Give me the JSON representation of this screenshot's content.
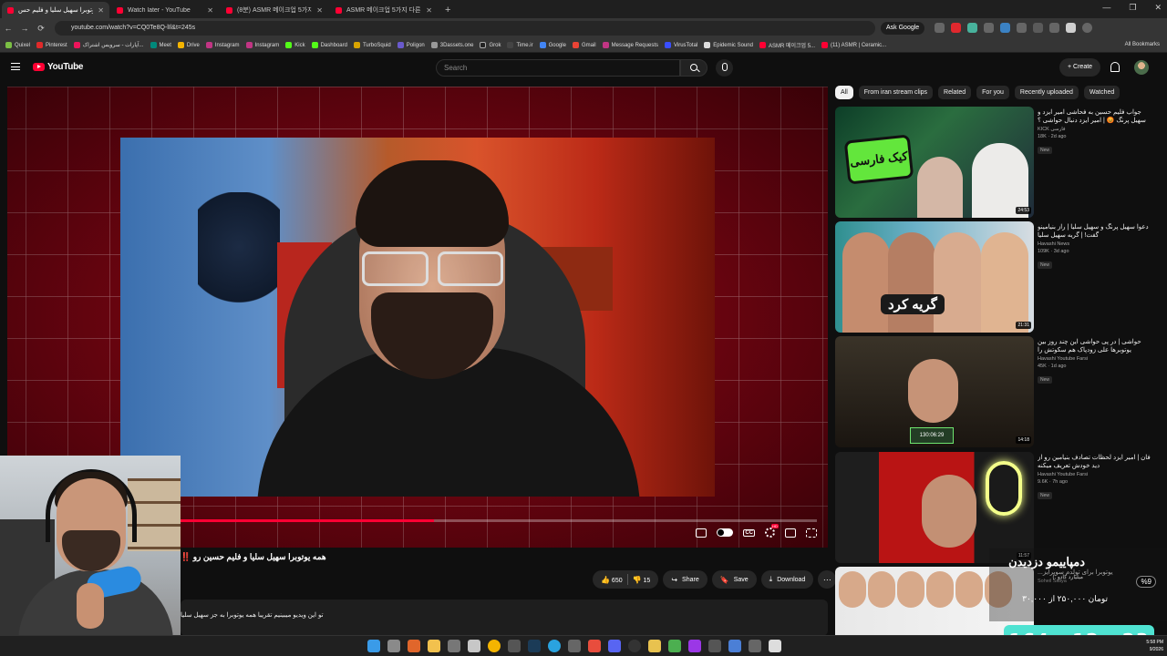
{
  "browser": {
    "tabs": [
      {
        "label": "همه یوتوبرا سهیل سلیا و فلیم حس...",
        "active": true
      },
      {
        "label": "Watch later - YouTube",
        "active": false
      },
      {
        "label": "(8분) ASMR 메이크업 5가지 ...",
        "active": false
      },
      {
        "label": "ASMR 메이크업 5가지 다른...",
        "active": false
      }
    ],
    "url": "youtube.com/watch?v=CQ0Te8Q-lIl&t=245s",
    "ask_google": "Ask Google",
    "bookmarks": [
      "Quixel",
      "Pinterest",
      "آپارات - سرویس اشتراک...",
      "Meet",
      "Drive",
      "Instagram",
      "Instagram",
      "Kick",
      "Dashboard",
      "TurboSquid",
      "Poligon",
      "3Dassets.one",
      "Grok",
      "Time.ir",
      "Google",
      "Gmail",
      "Message Requests",
      "VirusTotal",
      "Epidemic Sound",
      "ASMR 메이크업 5...",
      "(11) ASMR | Ceramic..."
    ],
    "all_bookmarks": "All Bookmarks"
  },
  "youtube": {
    "logo_text": "YouTube",
    "search_placeholder": "Search",
    "create_label": "Create"
  },
  "video": {
    "title": "همه یوتوبرا سهیل سلیا و فلیم حسین رو ‼️",
    "likes": "650",
    "dislikes": "15",
    "share_label": "Share",
    "save_label": "Save",
    "download_label": "Download",
    "description": "تو این ویدیو میبینیم تقریبا همه یوتوبرا به جز سهیل سلیا",
    "progress": 0.52
  },
  "chips": [
    "All",
    "From iran stream clips",
    "Related",
    "For you",
    "Recently uploaded",
    "Watched"
  ],
  "recommendations": [
    {
      "title": "جواب فلیم حسین به فحاشی امیر ایزد و سهیل پرنگ 😡 | امیر ایزد دنبال حواشی ؟",
      "channel": "KICK فارسی",
      "stats": "18K · 2d ago",
      "badge": "New",
      "duration": "24:53",
      "thumb_text": "کیک فارسی"
    },
    {
      "title": "دعوا سهیل پرنگ و سهیل سلیا | راز بنیامینو گفت! | گریه سهیل سلیا",
      "channel": "Havashi News",
      "stats": "109K · 3d ago",
      "badge": "New",
      "duration": "21:31",
      "thumb_text": "گریه کرد"
    },
    {
      "title": "حواشی | در پی حواشی این چند روز بین یوتوبرها علی زودپاک هم سکوتش را شکست",
      "channel": "Havashi Youtube Farsi",
      "stats": "45K · 1d ago",
      "badge": "New",
      "duration": "14:18",
      "thumb_text": "130:06:29"
    },
    {
      "title": "فان | امیر ایزد لحظات تصادف بنیامین رو از دید خودش تعریف میکنه",
      "channel": "Havashi Youtube Farsi",
      "stats": "9.6K · 7h ago",
      "badge": "New",
      "duration": "11:57",
      "thumb_text": ""
    },
    {
      "title": "یوتوبرا برای تولدم سوپرایز...",
      "channel": "Soheil Saliya",
      "stats": "",
      "badge": "",
      "duration": "",
      "thumb_text": ""
    }
  ],
  "overlay": {
    "name": "دمپاییمو دزدیدن",
    "subtitle": "میلیارد کادو :)",
    "amount": "تومان ۲۵۰,۰۰۰ از ۳۰,۰۰۰",
    "percent": "%9"
  },
  "timer": "164 : 12 : 23",
  "clock": {
    "time": "5:58 PM",
    "date": "9/2026"
  }
}
